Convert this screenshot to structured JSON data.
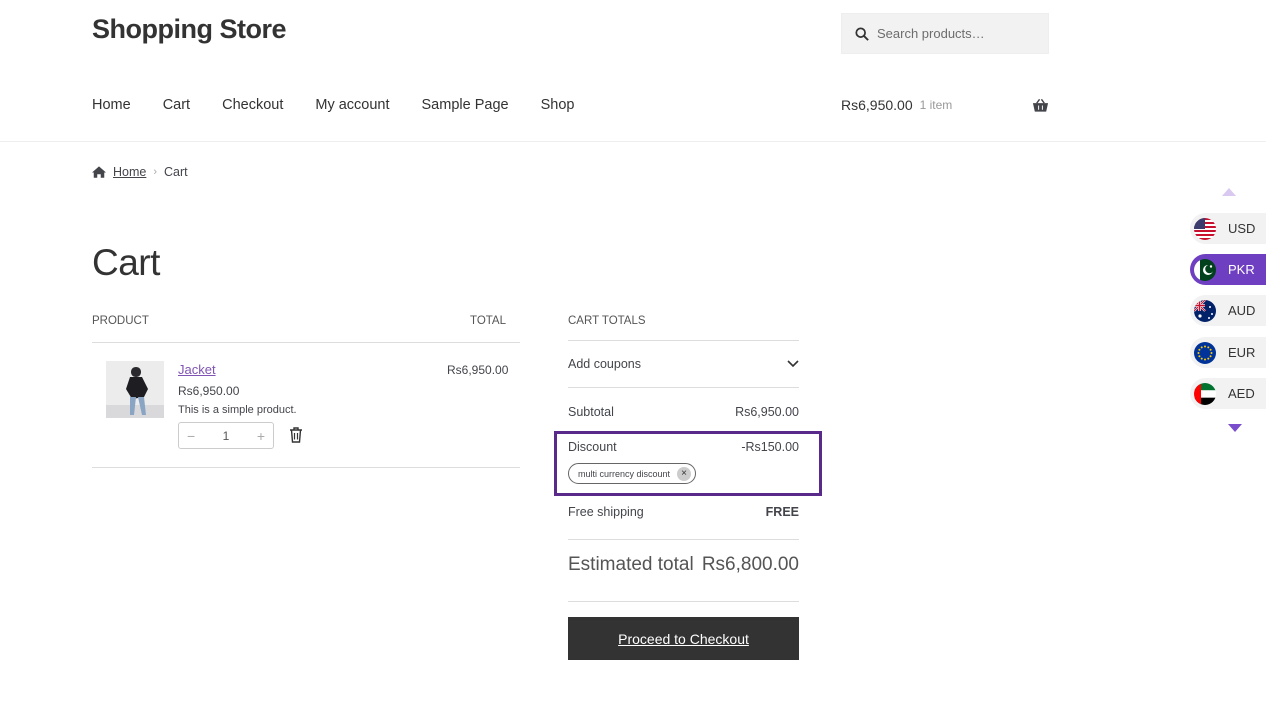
{
  "site": {
    "title": "Shopping Store"
  },
  "search": {
    "placeholder": "Search products…"
  },
  "nav": {
    "items": [
      "Home",
      "Cart",
      "Checkout",
      "My account",
      "Sample Page",
      "Shop"
    ]
  },
  "mini_cart": {
    "amount": "Rs6,950.00",
    "count": "1 item"
  },
  "breadcrumb": {
    "home": "Home",
    "separator": "›",
    "current": "Cart"
  },
  "page": {
    "title": "Cart"
  },
  "products_table": {
    "headers": {
      "product": "PRODUCT",
      "total": "TOTAL"
    },
    "items": [
      {
        "name": "Jacket",
        "price": "Rs6,950.00",
        "description": "This is a simple product.",
        "quantity": "1",
        "minus": "−",
        "plus": "+",
        "total": "Rs6,950.00"
      }
    ]
  },
  "cart_totals": {
    "heading": "CART TOTALS",
    "coupon_label": "Add coupons",
    "subtotal_label": "Subtotal",
    "subtotal_value": "Rs6,950.00",
    "discount_label": "Discount",
    "discount_value": "-Rs150.00",
    "coupon_chip": "multi currency discount",
    "coupon_remove": "×",
    "shipping_label": "Free shipping",
    "shipping_value": "FREE",
    "estimated_label": "Estimated total",
    "estimated_value": "Rs6,800.00",
    "checkout_button": "Proceed to Checkout"
  },
  "currency_switcher": {
    "active": "PKR",
    "items": [
      {
        "code": "USD",
        "icon": "us-flag-icon"
      },
      {
        "code": "PKR",
        "icon": "pk-flag-icon"
      },
      {
        "code": "AUD",
        "icon": "au-flag-icon"
      },
      {
        "code": "EUR",
        "icon": "eu-flag-icon"
      },
      {
        "code": "AED",
        "icon": "ae-flag-icon"
      }
    ],
    "active_color": "#6f3fc1"
  },
  "colors": {
    "link": "#7f54b3",
    "highlight_border": "#5a2a8a",
    "button_bg": "#333333"
  }
}
